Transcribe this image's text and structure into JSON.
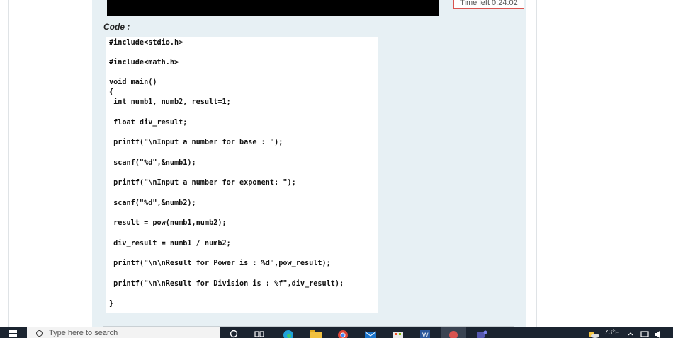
{
  "timer": {
    "text": "Time left 0:24:02"
  },
  "code": {
    "label": "Code :",
    "lines": [
      "#include<stdio.h>",
      "#include<math.h>",
      "void main()",
      "{",
      " int numb1, numb2, result=1;",
      " float div_result;",
      " printf(\"\\nInput a number for base : \");",
      " scanf(\"%d\",&numb1);",
      " printf(\"\\nInput a number for exponent: \");",
      " scanf(\"%d\",&numb2);",
      " result = pow(numb1,numb2);",
      " div_result = numb1 / numb2;",
      " printf(\"\\n\\nResult for Power is : %d\",pow_result);",
      " printf(\"\\n\\nResult for Division is : %f\",div_result);",
      "}"
    ]
  },
  "taskbar": {
    "search_placeholder": "Type here to search",
    "weather": "73°F",
    "icons": [
      "task-view-icon",
      "edge-icon",
      "file-explorer-icon",
      "chrome-icon",
      "mail-icon",
      "store-icon",
      "word-icon",
      "app-icon",
      "teams-icon"
    ],
    "colors": {
      "bar": "#1b2430",
      "accent": "#0078d4"
    }
  }
}
